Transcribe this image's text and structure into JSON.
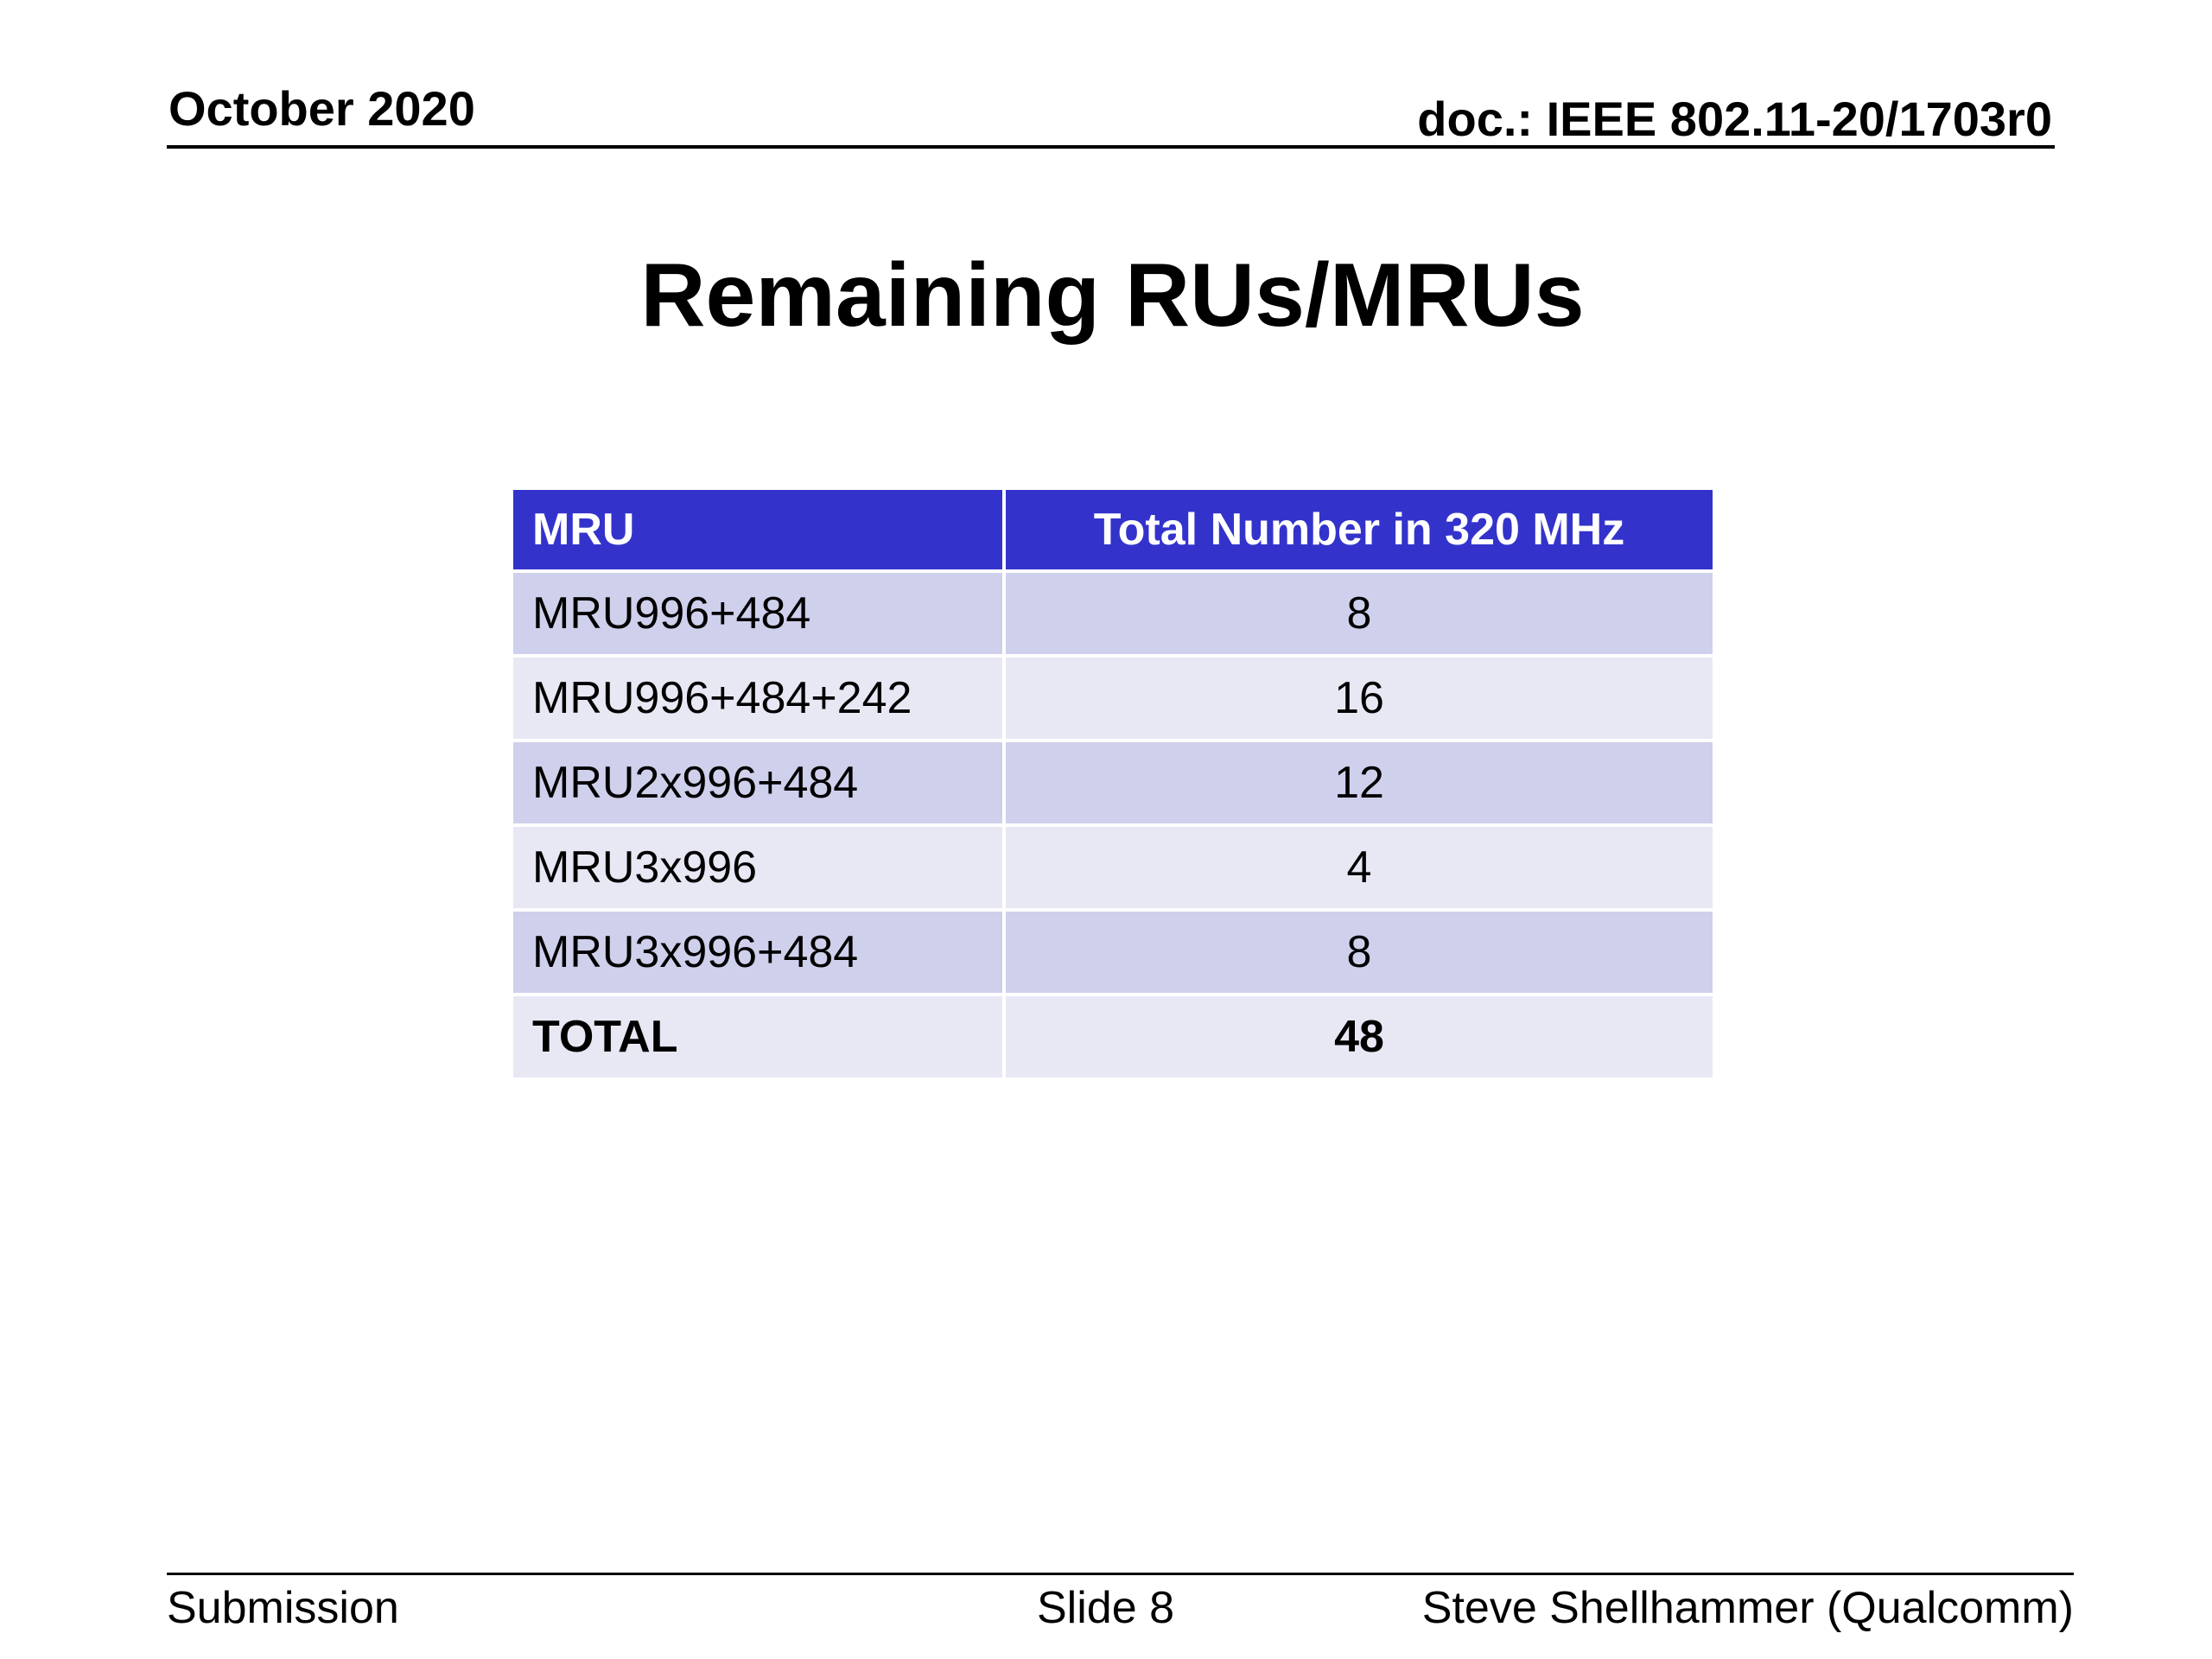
{
  "header": {
    "date": "October 2020",
    "doc": "doc.: IEEE 802.11-20/1703r0"
  },
  "title": "Remaining RUs/MRUs",
  "table": {
    "headers": [
      "MRU",
      "Total Number in 320 MHz"
    ],
    "rows": [
      {
        "mru": "MRU996+484",
        "count": "8"
      },
      {
        "mru": "MRU996+484+242",
        "count": "16"
      },
      {
        "mru": "MRU2x996+484",
        "count": "12"
      },
      {
        "mru": "MRU3x996",
        "count": "4"
      },
      {
        "mru": "MRU3x996+484",
        "count": "8"
      },
      {
        "mru": "TOTAL",
        "count": "48"
      }
    ]
  },
  "footer": {
    "left": "Submission",
    "center": "Slide 8",
    "right": "Steve Shellhammer (Qualcomm)"
  },
  "colors": {
    "header_row": "#3333cc",
    "row_band_dark": "#cfd0ec",
    "row_band_light": "#e8e8f5"
  }
}
